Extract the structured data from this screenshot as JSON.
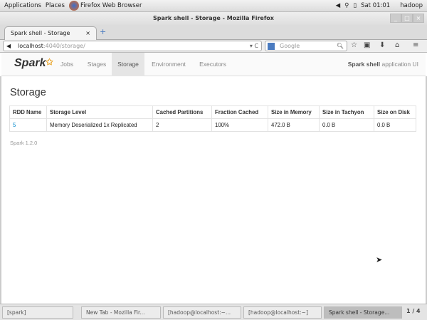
{
  "top_panel": {
    "applications": "Applications",
    "places": "Places",
    "app": "Firefox Web Browser",
    "clock": "Sat 01:01",
    "user": "hadoop"
  },
  "window": {
    "title": "Spark shell - Storage - Mozilla Firefox"
  },
  "browser": {
    "tab_label": "Spark shell - Storage",
    "url_host": "localhost",
    "url_rest": ":4040/storage/",
    "search_placeholder": "Google"
  },
  "spark_nav": {
    "logo": "Spark",
    "items": [
      "Jobs",
      "Stages",
      "Storage",
      "Environment",
      "Executors"
    ],
    "active": "Storage",
    "app_name": "Spark shell",
    "app_suffix": " application UI"
  },
  "page": {
    "title": "Storage",
    "footer": "Spark 1.2.0"
  },
  "table": {
    "headers": [
      "RDD Name",
      "Storage Level",
      "Cached Partitions",
      "Fraction Cached",
      "Size in Memory",
      "Size in Tachyon",
      "Size on Disk"
    ],
    "rows": [
      [
        "5",
        "Memory Deserialized 1x Replicated",
        "2",
        "100%",
        "472.0 B",
        "0.0 B",
        "0.0 B"
      ]
    ]
  },
  "taskbar": {
    "items": [
      "[spark]",
      "New Tab - Mozilla Fir...",
      "[hadoop@localhost:~...",
      "[hadoop@localhost:~]",
      "Spark shell - Storage..."
    ],
    "workspace": "1 / 4"
  }
}
